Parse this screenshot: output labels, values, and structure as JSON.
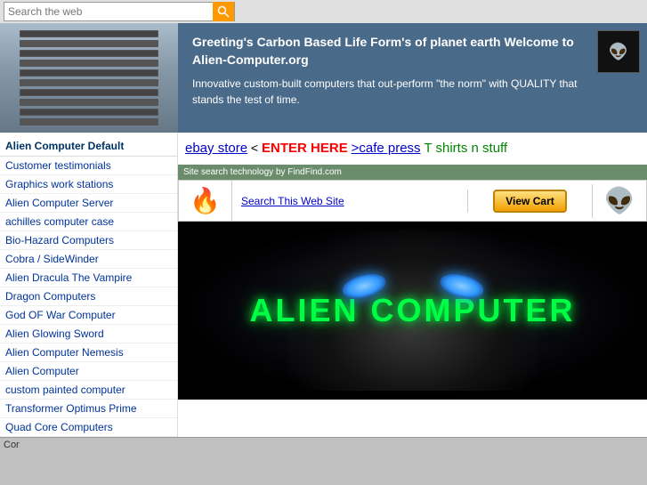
{
  "search": {
    "placeholder": "Search the web",
    "button_icon": "🔍"
  },
  "header": {
    "greeting": "Greeting's Carbon Based Life Form's of planet earth Welcome to Alien-Computer.org",
    "tagline": "Innovative custom-built computers that out-perform \"the norm\" with QUALITY that stands the test of time."
  },
  "sidebar": {
    "title": "Alien Computer Default",
    "items": [
      "Customer testimonials",
      "Graphics work stations",
      "Alien Computer Server",
      "achilles computer case",
      "Bio-Hazard Computers",
      "Cobra / SideWinder",
      "Alien Dracula The Vampire",
      "Dragon Computers",
      "God OF War Computer",
      "Alien Glowing Sword",
      "Alien Computer Nemesis",
      "Alien Computer",
      "custom painted computer",
      "Transformer Optimus Prime",
      "Quad Core Computers"
    ]
  },
  "store_links": {
    "ebay_text": "ebay store",
    "ebay_separator": " < ",
    "enter_here": "ENTER HERE",
    "cafe_text": ">cafe press",
    "tshirt_text": "T shirts n stuff"
  },
  "search_tool": {
    "powered_by": "Site search technology by FindFind.com",
    "search_link": "Search This Web Site"
  },
  "view_cart": {
    "label": "View Cart"
  },
  "alien_banner": {
    "title": "ALIEN COMPUTER"
  },
  "status_bar": {
    "text": "Cor"
  }
}
